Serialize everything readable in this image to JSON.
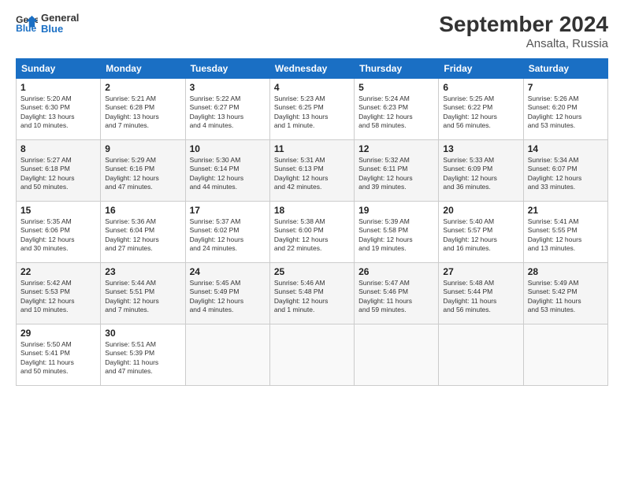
{
  "logo": {
    "line1": "General",
    "line2": "Blue"
  },
  "title": "September 2024",
  "subtitle": "Ansalta, Russia",
  "days_header": [
    "Sunday",
    "Monday",
    "Tuesday",
    "Wednesday",
    "Thursday",
    "Friday",
    "Saturday"
  ],
  "weeks": [
    [
      {
        "day": "1",
        "info": "Sunrise: 5:20 AM\nSunset: 6:30 PM\nDaylight: 13 hours\nand 10 minutes."
      },
      {
        "day": "2",
        "info": "Sunrise: 5:21 AM\nSunset: 6:28 PM\nDaylight: 13 hours\nand 7 minutes."
      },
      {
        "day": "3",
        "info": "Sunrise: 5:22 AM\nSunset: 6:27 PM\nDaylight: 13 hours\nand 4 minutes."
      },
      {
        "day": "4",
        "info": "Sunrise: 5:23 AM\nSunset: 6:25 PM\nDaylight: 13 hours\nand 1 minute."
      },
      {
        "day": "5",
        "info": "Sunrise: 5:24 AM\nSunset: 6:23 PM\nDaylight: 12 hours\nand 58 minutes."
      },
      {
        "day": "6",
        "info": "Sunrise: 5:25 AM\nSunset: 6:22 PM\nDaylight: 12 hours\nand 56 minutes."
      },
      {
        "day": "7",
        "info": "Sunrise: 5:26 AM\nSunset: 6:20 PM\nDaylight: 12 hours\nand 53 minutes."
      }
    ],
    [
      {
        "day": "8",
        "info": "Sunrise: 5:27 AM\nSunset: 6:18 PM\nDaylight: 12 hours\nand 50 minutes."
      },
      {
        "day": "9",
        "info": "Sunrise: 5:29 AM\nSunset: 6:16 PM\nDaylight: 12 hours\nand 47 minutes."
      },
      {
        "day": "10",
        "info": "Sunrise: 5:30 AM\nSunset: 6:14 PM\nDaylight: 12 hours\nand 44 minutes."
      },
      {
        "day": "11",
        "info": "Sunrise: 5:31 AM\nSunset: 6:13 PM\nDaylight: 12 hours\nand 42 minutes."
      },
      {
        "day": "12",
        "info": "Sunrise: 5:32 AM\nSunset: 6:11 PM\nDaylight: 12 hours\nand 39 minutes."
      },
      {
        "day": "13",
        "info": "Sunrise: 5:33 AM\nSunset: 6:09 PM\nDaylight: 12 hours\nand 36 minutes."
      },
      {
        "day": "14",
        "info": "Sunrise: 5:34 AM\nSunset: 6:07 PM\nDaylight: 12 hours\nand 33 minutes."
      }
    ],
    [
      {
        "day": "15",
        "info": "Sunrise: 5:35 AM\nSunset: 6:06 PM\nDaylight: 12 hours\nand 30 minutes."
      },
      {
        "day": "16",
        "info": "Sunrise: 5:36 AM\nSunset: 6:04 PM\nDaylight: 12 hours\nand 27 minutes."
      },
      {
        "day": "17",
        "info": "Sunrise: 5:37 AM\nSunset: 6:02 PM\nDaylight: 12 hours\nand 24 minutes."
      },
      {
        "day": "18",
        "info": "Sunrise: 5:38 AM\nSunset: 6:00 PM\nDaylight: 12 hours\nand 22 minutes."
      },
      {
        "day": "19",
        "info": "Sunrise: 5:39 AM\nSunset: 5:58 PM\nDaylight: 12 hours\nand 19 minutes."
      },
      {
        "day": "20",
        "info": "Sunrise: 5:40 AM\nSunset: 5:57 PM\nDaylight: 12 hours\nand 16 minutes."
      },
      {
        "day": "21",
        "info": "Sunrise: 5:41 AM\nSunset: 5:55 PM\nDaylight: 12 hours\nand 13 minutes."
      }
    ],
    [
      {
        "day": "22",
        "info": "Sunrise: 5:42 AM\nSunset: 5:53 PM\nDaylight: 12 hours\nand 10 minutes."
      },
      {
        "day": "23",
        "info": "Sunrise: 5:44 AM\nSunset: 5:51 PM\nDaylight: 12 hours\nand 7 minutes."
      },
      {
        "day": "24",
        "info": "Sunrise: 5:45 AM\nSunset: 5:49 PM\nDaylight: 12 hours\nand 4 minutes."
      },
      {
        "day": "25",
        "info": "Sunrise: 5:46 AM\nSunset: 5:48 PM\nDaylight: 12 hours\nand 1 minute."
      },
      {
        "day": "26",
        "info": "Sunrise: 5:47 AM\nSunset: 5:46 PM\nDaylight: 11 hours\nand 59 minutes."
      },
      {
        "day": "27",
        "info": "Sunrise: 5:48 AM\nSunset: 5:44 PM\nDaylight: 11 hours\nand 56 minutes."
      },
      {
        "day": "28",
        "info": "Sunrise: 5:49 AM\nSunset: 5:42 PM\nDaylight: 11 hours\nand 53 minutes."
      }
    ],
    [
      {
        "day": "29",
        "info": "Sunrise: 5:50 AM\nSunset: 5:41 PM\nDaylight: 11 hours\nand 50 minutes."
      },
      {
        "day": "30",
        "info": "Sunrise: 5:51 AM\nSunset: 5:39 PM\nDaylight: 11 hours\nand 47 minutes."
      },
      {
        "day": "",
        "info": ""
      },
      {
        "day": "",
        "info": ""
      },
      {
        "day": "",
        "info": ""
      },
      {
        "day": "",
        "info": ""
      },
      {
        "day": "",
        "info": ""
      }
    ]
  ]
}
